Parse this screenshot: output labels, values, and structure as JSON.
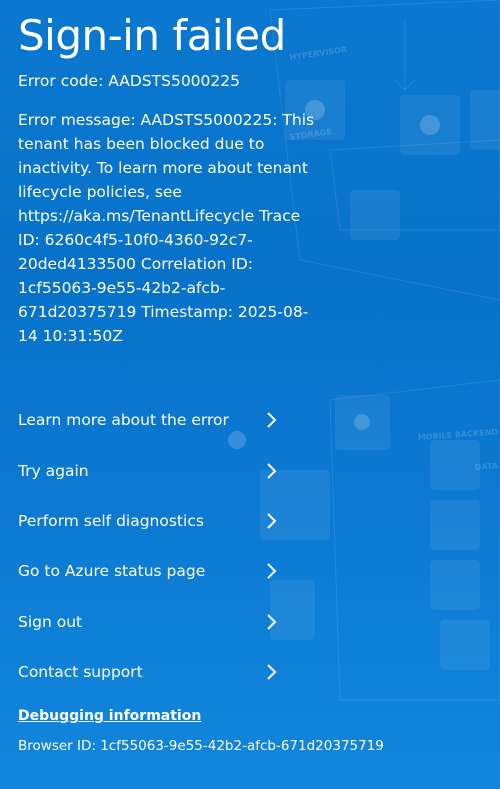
{
  "page": {
    "title": "Sign-in failed",
    "error_code": "Error code: AADSTS5000225",
    "error_message": "Error message: AADSTS5000225: This tenant has been blocked due to inactivity. To learn more about tenant lifecycle policies, see https://aka.ms/TenantLifecycle Trace ID: 6260c4f5-10f0-4360-92c7-20ded4133500 Correlation ID: 1cf55063-9e55-42b2-afcb-671d20375719 Timestamp: 2025-08-14 10:31:50Z"
  },
  "links": [
    {
      "id": "learn-more",
      "label": "Learn more about the error"
    },
    {
      "id": "try-again",
      "label": "Try again"
    },
    {
      "id": "self-diagnostics",
      "label": "Perform self diagnostics"
    },
    {
      "id": "azure-status",
      "label": "Go to Azure status page"
    },
    {
      "id": "sign-out",
      "label": "Sign out"
    },
    {
      "id": "contact-support",
      "label": "Contact support"
    }
  ],
  "debug": {
    "title": "Debugging information",
    "browser_id": "Browser ID: 1cf55063-9e55-42b2-afcb-671d20375719"
  },
  "background": {
    "labels": [
      "HYPERVISOR",
      "STORAGE",
      "MOBILE BACKEND",
      "DATA"
    ]
  },
  "colors": {
    "background_top": "#0a78d0",
    "background_bottom": "#1286dc",
    "text": "#ffffff"
  }
}
